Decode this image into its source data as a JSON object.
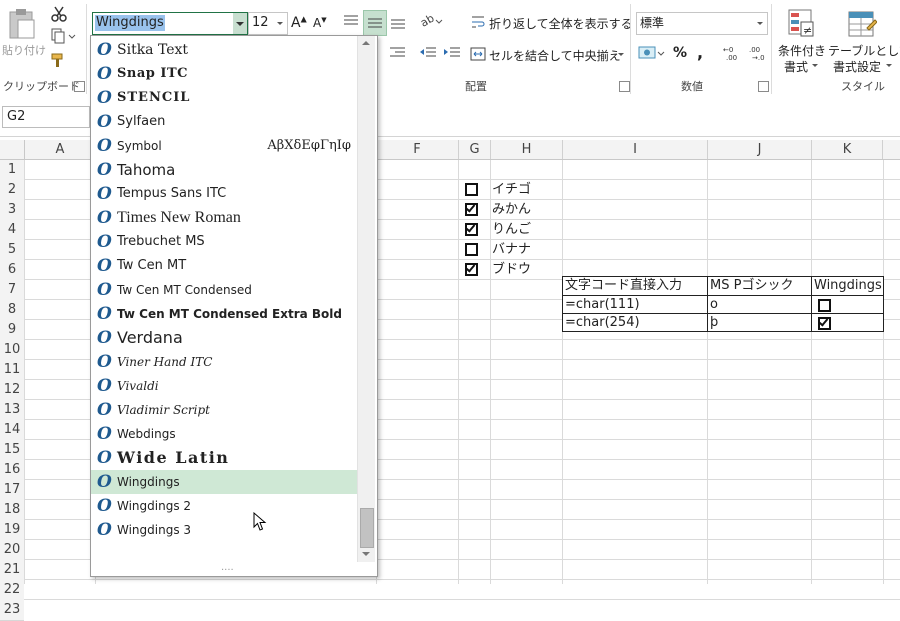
{
  "font_box": {
    "value": "Wingdings"
  },
  "size_box": {
    "value": "12"
  },
  "clipboard": {
    "paste_label": "貼り付け",
    "group_label": "クリップボード"
  },
  "alignment": {
    "wrap_label": "折り返して全体を表示する",
    "merge_label": "セルを結合して中央揃え",
    "group_label": "配置"
  },
  "number": {
    "format_value": "標準",
    "group_label": "数値"
  },
  "styles": {
    "conditional_l1": "条件付き",
    "conditional_l2": "書式",
    "table_l1": "テーブルとして",
    "table_l2": "書式設定",
    "group_label": "スタイル"
  },
  "name_box": {
    "value": "G2"
  },
  "columns": [
    "A",
    "F",
    "G",
    "H",
    "I",
    "J",
    "K"
  ],
  "rows": [
    "1",
    "2",
    "3",
    "4",
    "5",
    "6",
    "7",
    "8",
    "9",
    "10",
    "11",
    "12",
    "13",
    "14",
    "15",
    "16",
    "17",
    "18",
    "19",
    "20",
    "21",
    "22",
    "23"
  ],
  "checklist": [
    {
      "label": "イチゴ",
      "checked": false
    },
    {
      "label": "みかん",
      "checked": true
    },
    {
      "label": "りんご",
      "checked": true
    },
    {
      "label": "バナナ",
      "checked": false
    },
    {
      "label": "ブドウ",
      "checked": true
    }
  ],
  "table": {
    "headers": [
      "文字コード直接入力",
      "MS Pゴシック",
      "Wingdings"
    ],
    "rows": [
      {
        "formula": "=char(111)",
        "char": "o",
        "checked": false
      },
      {
        "formula": "=char(254)",
        "char": "þ",
        "checked": true
      }
    ]
  },
  "font_list": [
    {
      "name": "Sitka Text"
    },
    {
      "name": "Snap ITC"
    },
    {
      "name": "STENCIL"
    },
    {
      "name": "Sylfaen"
    },
    {
      "name": "Symbol",
      "sample": "ΑβΧδΕφΓηΙφ"
    },
    {
      "name": "Tahoma"
    },
    {
      "name": "Tempus Sans ITC"
    },
    {
      "name": "Times New Roman"
    },
    {
      "name": "Trebuchet MS"
    },
    {
      "name": "Tw Cen MT"
    },
    {
      "name": "Tw Cen MT Condensed"
    },
    {
      "name": "Tw Cen MT Condensed Extra Bold"
    },
    {
      "name": "Verdana"
    },
    {
      "name": "Viner Hand ITC"
    },
    {
      "name": "Vivaldi"
    },
    {
      "name": "Vladimir Script"
    },
    {
      "name": "Webdings"
    },
    {
      "name": "Wide Latin"
    },
    {
      "name": "Wingdings"
    },
    {
      "name": "Wingdings 2"
    },
    {
      "name": "Wingdings 3"
    }
  ],
  "highlight_color": "#cfe8d5",
  "accent_color": "#217346"
}
